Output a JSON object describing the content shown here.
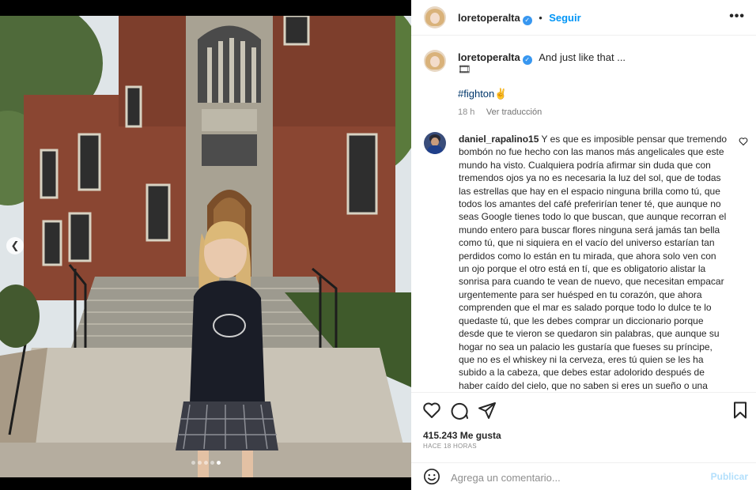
{
  "post": {
    "author": "loretoperalta",
    "follow_label": "Seguir",
    "more_icon": "more-horizontal-icon",
    "caption": "And just like that ...",
    "caption_emoji": "🎞",
    "hashtag": "#fighton✌",
    "age": "18 h",
    "translate_label": "Ver traducción",
    "carousel": {
      "total": 5,
      "active_index": 4
    }
  },
  "comment": {
    "author": "daniel_rapalino15",
    "text": "Y es que es imposible pensar que tremendo bombón no fue hecho con las manos más angelicales que este mundo ha visto. Cualquiera podría afirmar sin duda que con tremendos ojos ya no es necesaria la luz del sol, que de todas las estrellas que hay en el espacio ninguna brilla como tú, que todos los amantes del café preferirían tener té, que aunque no seas Google tienes todo lo que buscan, que aunque recorran el mundo entero para buscar flores ninguna será jamás tan bella como tú, que ni siquiera en el vacío del universo estarían tan perdidos como lo están en tu mirada, que ahora solo ven con un ojo porque el otro está en tí, que es obligatorio alistar la sonrisa para cuando te vean de nuevo, que necesitan empacar urgentemente para ser huésped en tu corazón, que ahora comprenden que el mar es salado porque todo lo dulce te lo quedaste tú, que les debes comprar un diccionario porque desde que te vieron se quedaron sin palabras, que aunque su hogar no sea un palacio les gustaría que fueses su príncipe, que no es el whiskey ni la cerveza, eres tú quien se les ha subido a la cabeza, que debes estar adolorido después de haber caído del cielo, que no saben si eres un sueño o una realidad, pero que si están soñando no se quieren despertar."
  },
  "stats": {
    "likes": "415.243 Me gusta",
    "posted_ago": "HACE 18 HORAS"
  },
  "composer": {
    "placeholder": "Agrega un comentario...",
    "publish_label": "Publicar"
  },
  "colors": {
    "link_blue": "#0095f6",
    "hashtag_blue": "#00376b",
    "muted_gray": "#8e8e8e",
    "publish_disabled": "#b2dffc"
  }
}
